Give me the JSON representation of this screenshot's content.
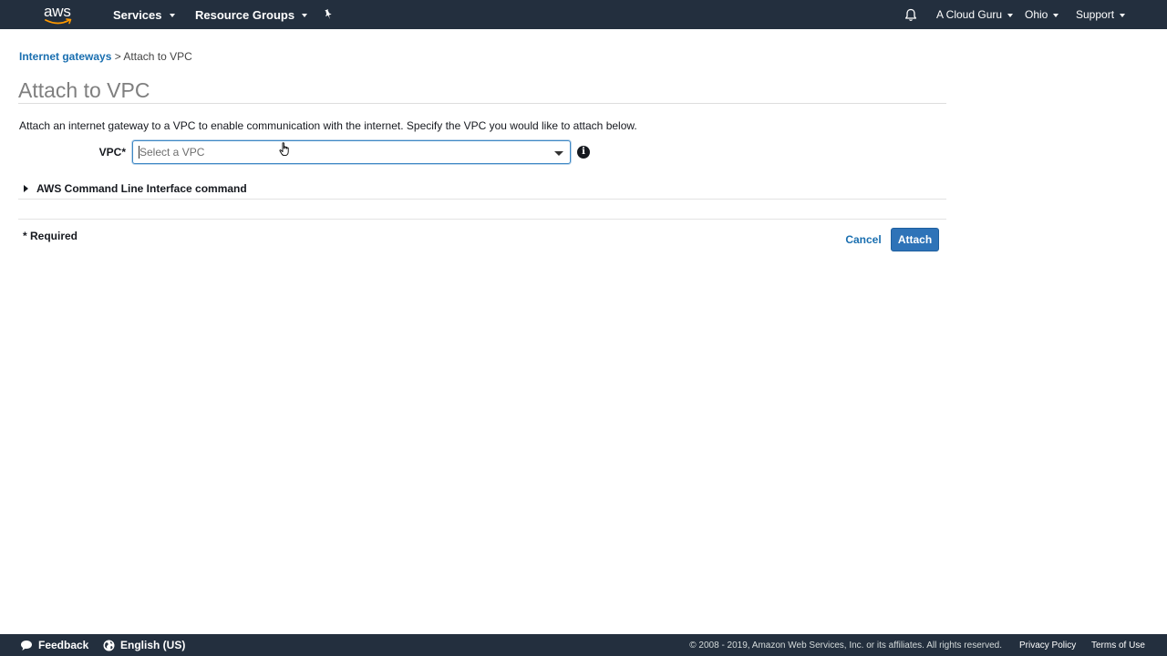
{
  "topnav": {
    "logo_text": "aws",
    "services_label": "Services",
    "resource_groups_label": "Resource Groups",
    "pin_icon": "pushpin-icon",
    "bell_icon": "bell-icon",
    "account_label": "A Cloud Guru",
    "region_label": "Ohio",
    "support_label": "Support"
  },
  "breadcrumb": {
    "parent_label": "Internet gateways",
    "separator": ">",
    "current_label": "Attach to VPC"
  },
  "page": {
    "title": "Attach to VPC",
    "description": "Attach an internet gateway to a VPC to enable communication with the internet. Specify the VPC you would like to attach below."
  },
  "form": {
    "vpc_label": "VPC*",
    "vpc_placeholder": "Select a VPC",
    "vpc_value": "",
    "info_icon": "info-icon",
    "cli_toggle_label": "AWS Command Line Interface command",
    "required_note": "* Required",
    "cancel_label": "Cancel",
    "attach_label": "Attach"
  },
  "footer": {
    "feedback_label": "Feedback",
    "language_label": "English (US)",
    "copyright": "© 2008 - 2019, Amazon Web Services, Inc. or its affiliates. All rights reserved.",
    "privacy_label": "Privacy Policy",
    "terms_label": "Terms of Use"
  },
  "colors": {
    "nav_background": "#232f3e",
    "link_blue": "#1a6fb0",
    "primary_button": "#2e73b8",
    "title_gray": "#7f7f7f",
    "focus_border": "#3f88c5"
  }
}
